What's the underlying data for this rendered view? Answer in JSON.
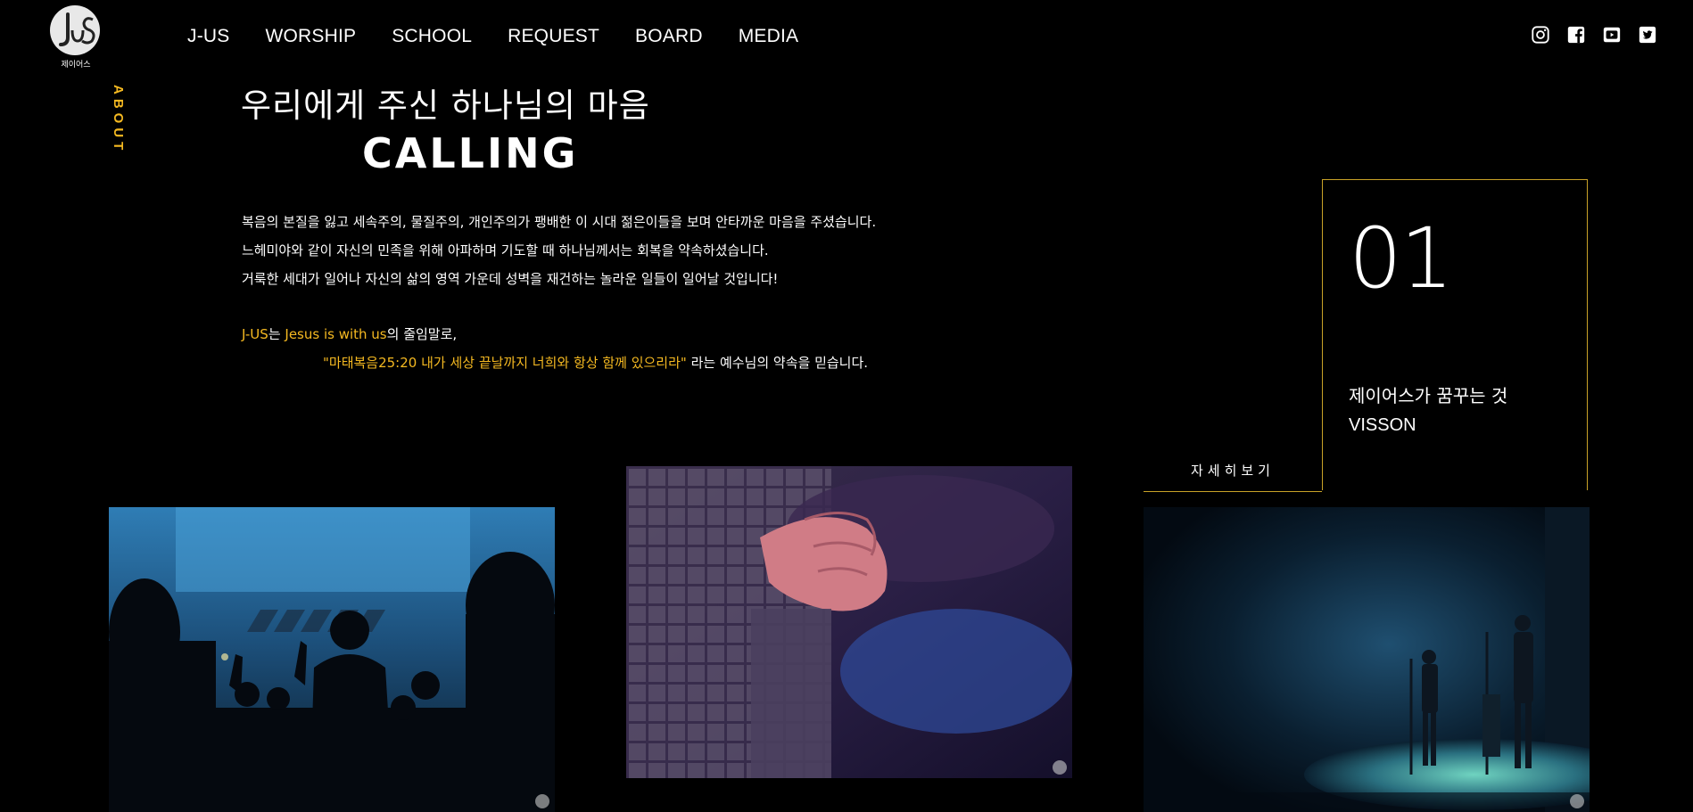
{
  "brand": {
    "logo_text": "제이어스"
  },
  "nav": {
    "items": [
      "J-US",
      "WORSHIP",
      "SCHOOL",
      "REQUEST",
      "BOARD",
      "MEDIA"
    ]
  },
  "social": [
    "instagram-icon",
    "facebook-icon",
    "youtube-icon",
    "twitter-icon"
  ],
  "section": {
    "label": "ABOUT"
  },
  "hero": {
    "heading_ko": "우리에게 주신 하나님의 마음",
    "heading_en": "CALLING"
  },
  "body": {
    "line1": "복음의 본질을 잃고 세속주의, 물질주의, 개인주의가 팽배한 이 시대 젊은이들을 보며 안타까운 마음을 주셨습니다.",
    "line2": "느헤미야와 같이 자신의 민족을 위해 아파하며 기도할 때 하나님께서는 회복을 약속하셨습니다.",
    "line3": "거룩한 세대가 일어나 자신의 삶의 영역 가운데 성벽을 재건하는 놀라운 일들이 일어날 것입니다!",
    "line4_highlight1": "J-US",
    "line4_text1": "는 ",
    "line4_highlight2": "Jesus is with us",
    "line4_text2": "의 줄임말로,",
    "line5_highlight": "\"마태복음25:20 내가 세상 끝날까지 너희와 항상 함께 있으리라\"",
    "line5_text": " 라는 예수님의 약속을 믿습니다."
  },
  "feature": {
    "number": "01",
    "subtitle": "제이어스가 꿈꾸는 것",
    "title": "VISSON",
    "more_label": "자세히보기"
  },
  "colors": {
    "background": "#000000",
    "accent": "#f5b921",
    "border": "#c9a227"
  }
}
